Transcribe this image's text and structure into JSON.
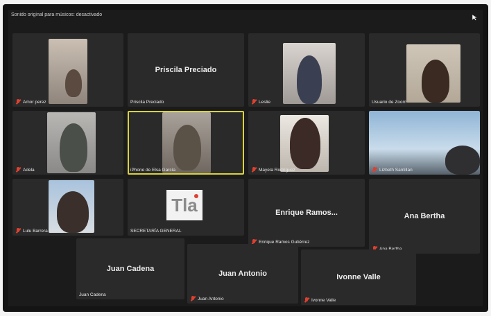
{
  "banner": "Sonido original para músicos: desactivado",
  "tiles": {
    "amor_perez": "Amor perez",
    "priscila_name": "Priscila Preciado",
    "priscila_label": "Priscila Preciado",
    "leslie": "Leslie",
    "usuario_zoom": "Usuario de Zoom",
    "adela": "Adela",
    "iphone_elsa": "iPhone de Elsa García",
    "mayela": "Mayela Rodríguez",
    "lizbeth": "Lizbeth Santillan",
    "lulu": "Lulu Barrera",
    "secretaria_logo": "Tla",
    "secretaria": "SECRETARÍA GENERAL",
    "enrique_name": "Enrique  Ramos...",
    "enrique_label": "Enrique Ramos Gutiérrez",
    "ana_name": "Ana Bertha",
    "ana_label": "Ana Bertha",
    "juan_cadena_name": "Juan Cadena",
    "juan_cadena_label": "Juan Cadena",
    "juan_antonio_name": "Juan Antonio",
    "juan_antonio_label": "Juan Antonio",
    "ivonne_name": "Ivonne Valle",
    "ivonne_label": "Ivonne Valle"
  },
  "colors": {
    "active_speaker": "#d9d33c",
    "mute": "#e0402f",
    "tile_bg": "#2a2a2a"
  }
}
